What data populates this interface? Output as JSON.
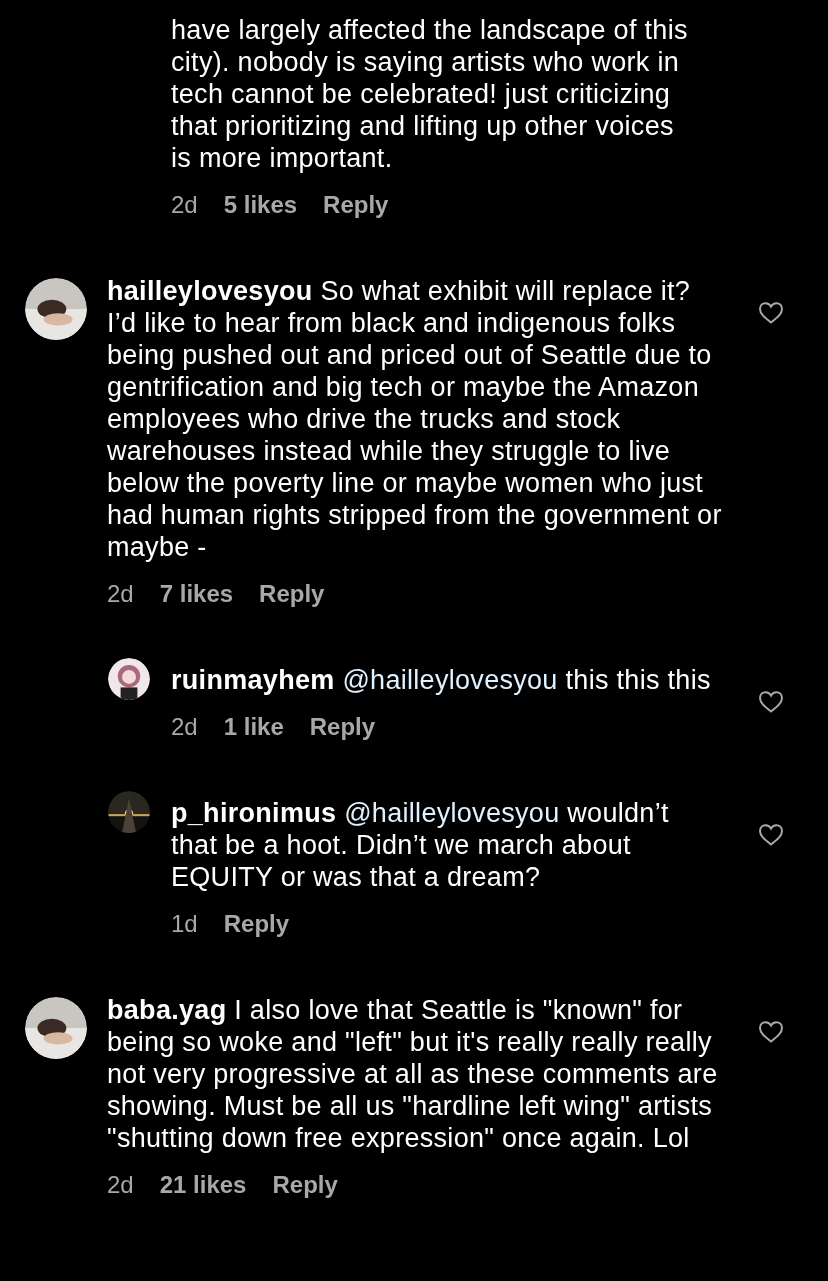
{
  "comments": [
    {
      "kind": "continued",
      "text": "have largely affected the landscape of this city). nobody is saying artists who work in tech cannot be celebrated! just criticizing that prioritizing and lifting up other voices is more important.",
      "time": "2d",
      "likes": "5 likes",
      "reply": "Reply"
    },
    {
      "kind": "top",
      "user": "hailleylovesyou",
      "text": "So what exhibit will replace it? I’d like to hear from black and indigenous folks being pushed out and priced out of Seattle due to gentrification and big tech or maybe the Amazon employees who drive the trucks and stock warehouses instead while they struggle to live below the poverty line or maybe women who just had human rights stripped from the government or maybe -",
      "time": "2d",
      "likes": "7 likes",
      "reply": "Reply"
    },
    {
      "kind": "reply",
      "user": "ruinmayhem",
      "mention": "@hailleylovesyou",
      "text": "this this this",
      "time": "2d",
      "likes": "1 like",
      "reply": "Reply"
    },
    {
      "kind": "reply",
      "user": "p_hironimus",
      "mention": "@hailleylovesyou",
      "text": "wouldn’t that be a hoot. Didn’t we march about EQUITY or was that a dream?",
      "time": "1d",
      "reply": "Reply"
    },
    {
      "kind": "top",
      "user": "baba.yag",
      "text": "I also love that Seattle is \"known\" for being so woke and \"left\" but it's really really really not very progressive at all as these comments are showing. Must be all us \"hardline left wing\" artists \"shutting down free expression\" once again. Lol",
      "time": "2d",
      "likes": "21 likes",
      "reply": "Reply"
    }
  ]
}
